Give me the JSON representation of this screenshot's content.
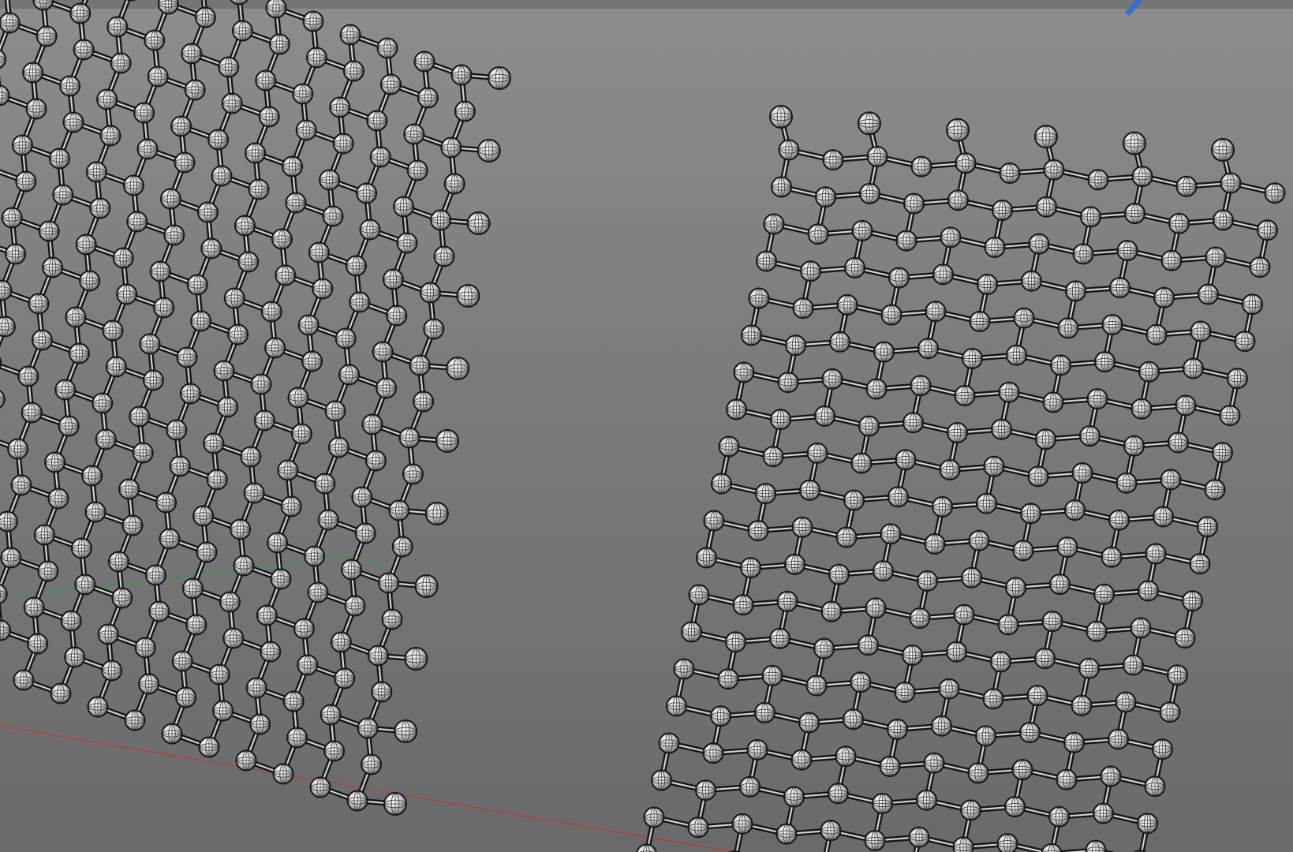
{
  "viewport": {
    "view": "perspective",
    "background_colors": [
      "#8d8d8d",
      "#6a6a6a"
    ]
  },
  "axes": {
    "x_axis_color": "#c0392b",
    "y_axis_color": "#2f9e44",
    "z_axis_color": "#2f6fd6"
  },
  "scene": {
    "object_type": "graphene-nanoribbon",
    "ribbon_count": 2,
    "atom_style": "wireframe-sphere",
    "bond_style": "double-line",
    "terminal_atoms": "hydrogen",
    "atom_color": "#dcdcdc",
    "bond_color": "#1a1a1a"
  }
}
